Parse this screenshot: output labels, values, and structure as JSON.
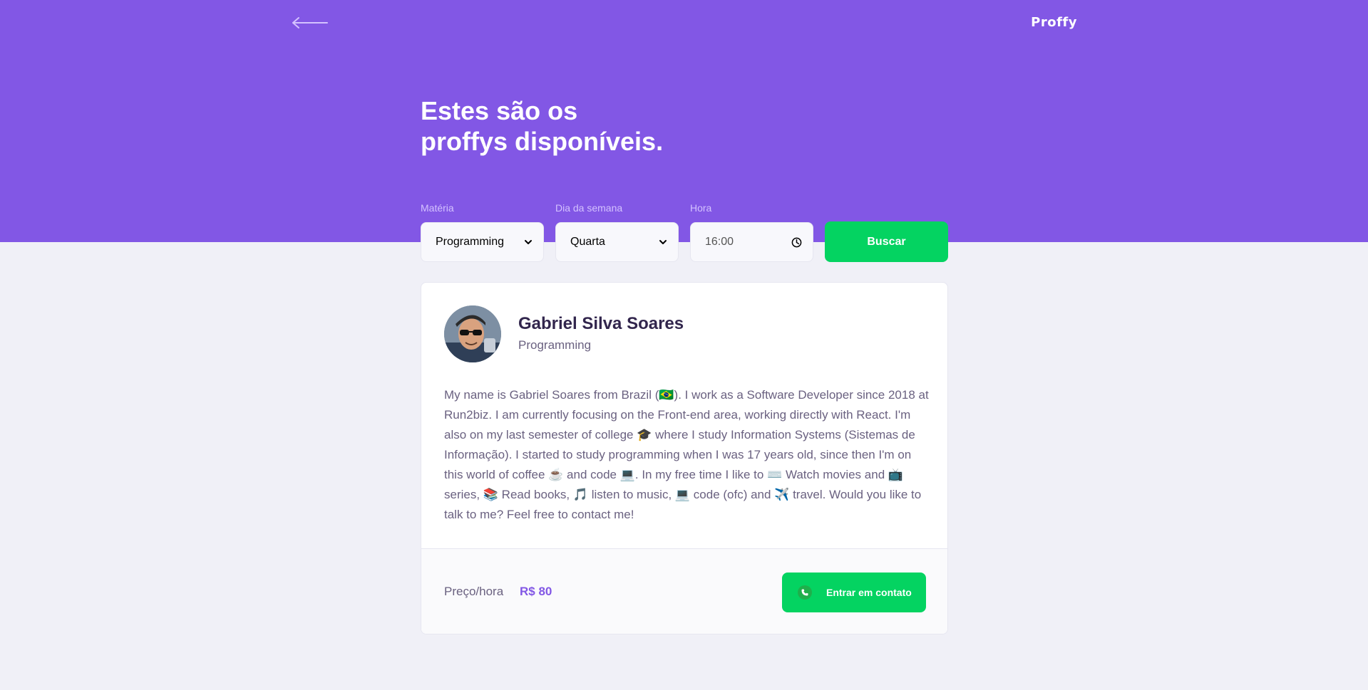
{
  "header": {
    "back_icon": "arrow-left-icon",
    "logo": "Proffy",
    "title_line1": "Estes são os",
    "title_line2": "proffys disponíveis.",
    "background_color": "#8257e5"
  },
  "filters": {
    "subject": {
      "label": "Matéria",
      "value": "Programming"
    },
    "weekday": {
      "label": "Dia da semana",
      "value": "Quarta"
    },
    "time": {
      "label": "Hora",
      "value": "16:00"
    },
    "search_button": "Buscar",
    "accent_color": "#04d361"
  },
  "teacher": {
    "name": "Gabriel Silva Soares",
    "subject": "Programming",
    "bio": "My name is Gabriel Soares from Brazil (🇧🇷). I work as a Software Developer since 2018 at Run2biz. I am currently focusing on the Front-end area, working directly with React. I'm also on my last semester of college 🎓 where I study Information Systems (Sistemas de Informação). I started to study programming when I was 17 years old, since then I'm on this world of coffee ☕ and code 💻. In my free time I like to ⌨️ Watch movies and 📺 series, 📚 Read books, 🎵 listen to music, 💻 code (ofc) and ✈️ travel. Would you like to talk to me? Feel free to contact me!",
    "price_label": "Preço/hora",
    "price_value": "R$ 80",
    "contact_button": "Entrar em contato",
    "contact_icon": "whatsapp-icon"
  }
}
